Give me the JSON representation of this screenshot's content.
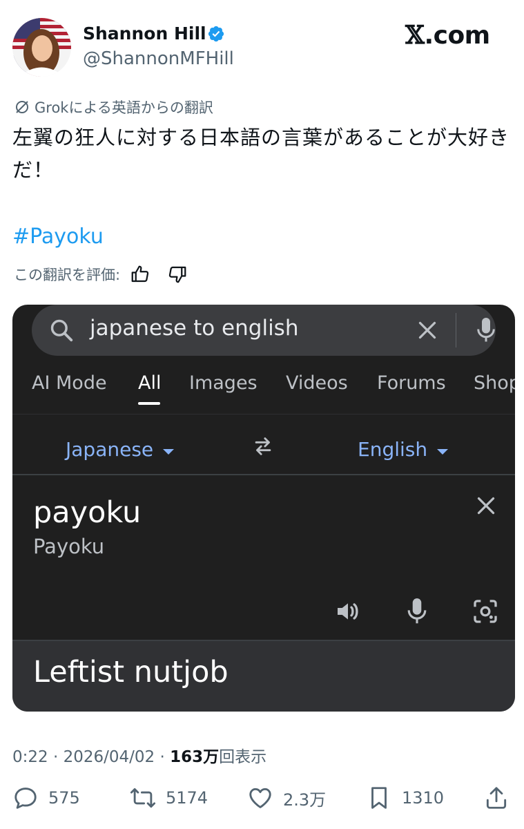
{
  "author": {
    "name": "Shannon Hill",
    "handle": "@ShannonMFHill",
    "verified_color": "#1d9bf0"
  },
  "brand": {
    "x": "𝕏",
    "suffix": ".com"
  },
  "post": {
    "translated_label": "Grokによる英語からの翻訳",
    "text": "左翼の狂人に対する日本語の言葉があることが大好きだ！",
    "hashtag": "#Payoku",
    "rate_label": "この翻訳を評価:"
  },
  "screenshot": {
    "search": {
      "query": "japanese to english"
    },
    "tabs": [
      {
        "label": "AI Mode"
      },
      {
        "label": "All",
        "active": true
      },
      {
        "label": "Images"
      },
      {
        "label": "Videos"
      },
      {
        "label": "Forums"
      },
      {
        "label": "Shop"
      }
    ],
    "source_lang": "Japanese",
    "target_lang": "English",
    "source_text": "payoku",
    "source_transliteration": "Payoku",
    "result_text": "Leftist nutjob"
  },
  "meta": {
    "time": "0:22",
    "sep": "·",
    "date": "2026/04/02",
    "views_count": "163万",
    "views_label": "回表示"
  },
  "actions": {
    "replies": "575",
    "reposts": "5174",
    "likes": "2.3万",
    "bookmarks": "1310"
  },
  "colors": {
    "accent_blue": "#1d9bf0",
    "muted_text": "#536471",
    "google_link_blue": "#8ab4f8",
    "card_bg": "#1f1f1f"
  }
}
